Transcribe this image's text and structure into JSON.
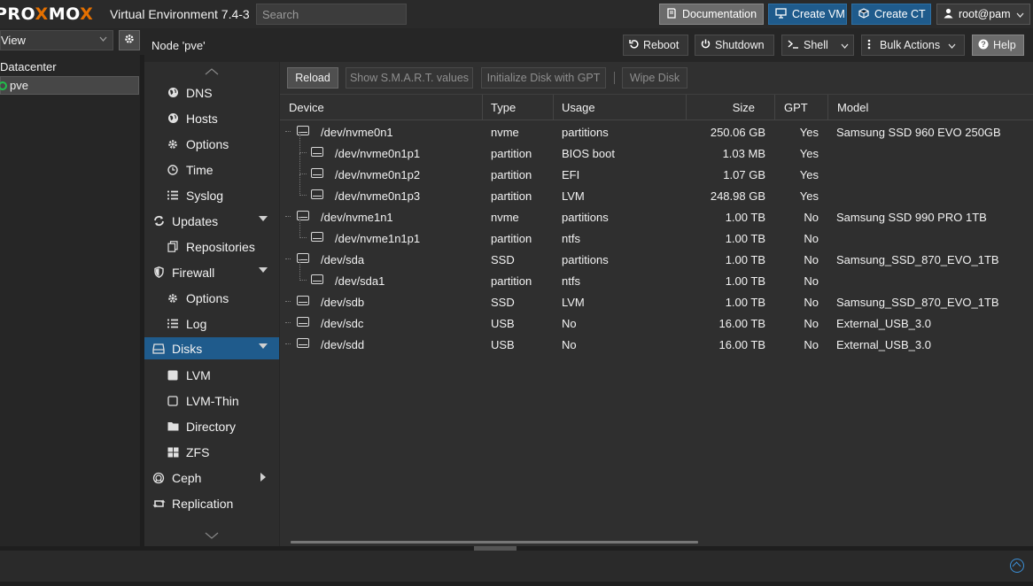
{
  "app": {
    "logo_prefix": "PRO",
    "logo_x": "X",
    "logo_suffix": "MO",
    "logo_x2": "X",
    "version": "Virtual Environment 7.4-3"
  },
  "search": {
    "placeholder": "Search"
  },
  "topbar": {
    "documentation": "Documentation",
    "create_vm": "Create VM",
    "create_ct": "Create CT",
    "user": "root@pam"
  },
  "view": {
    "selected": "View"
  },
  "tree": {
    "datacenter": "Datacenter",
    "node": "pve"
  },
  "node_header": {
    "title": "Node 'pve'",
    "reboot": "Reboot",
    "shutdown": "Shutdown",
    "shell": "Shell",
    "bulk_actions": "Bulk Actions",
    "help": "Help"
  },
  "menu": {
    "items": [
      {
        "label": "DNS",
        "icon": "globe-icon"
      },
      {
        "label": "Hosts",
        "icon": "globe-icon"
      },
      {
        "label": "Options",
        "icon": "gear-icon"
      },
      {
        "label": "Time",
        "icon": "clock-icon"
      },
      {
        "label": "Syslog",
        "icon": "list-icon"
      },
      {
        "label": "Updates",
        "icon": "refresh-icon"
      },
      {
        "label": "Repositories",
        "icon": "files-icon"
      },
      {
        "label": "Firewall",
        "icon": "shield-icon"
      },
      {
        "label": "Options",
        "icon": "gear-icon"
      },
      {
        "label": "Log",
        "icon": "list-icon"
      },
      {
        "label": "Disks",
        "icon": "drive-icon"
      },
      {
        "label": "LVM",
        "icon": "square-filled-icon"
      },
      {
        "label": "LVM-Thin",
        "icon": "square-outline-icon"
      },
      {
        "label": "Directory",
        "icon": "folder-icon"
      },
      {
        "label": "ZFS",
        "icon": "grid-icon"
      },
      {
        "label": "Ceph",
        "icon": "ceph-icon"
      },
      {
        "label": "Replication",
        "icon": "retweet-icon"
      }
    ]
  },
  "toolbar": {
    "reload": "Reload",
    "smart": "Show S.M.A.R.T. values",
    "init_gpt": "Initialize Disk with GPT",
    "wipe": "Wipe Disk"
  },
  "grid": {
    "columns": [
      "Device",
      "Type",
      "Usage",
      "Size",
      "GPT",
      "Model"
    ],
    "rows": [
      {
        "device": "/dev/nvme0n1",
        "type": "nvme",
        "usage": "partitions",
        "size": "250.06 GB",
        "gpt": "Yes",
        "model": "Samsung SSD 960 EVO 250GB",
        "depth": 0
      },
      {
        "device": "/dev/nvme0n1p1",
        "type": "partition",
        "usage": "BIOS boot",
        "size": "1.03 MB",
        "gpt": "Yes",
        "model": "",
        "depth": 1
      },
      {
        "device": "/dev/nvme0n1p2",
        "type": "partition",
        "usage": "EFI",
        "size": "1.07 GB",
        "gpt": "Yes",
        "model": "",
        "depth": 1
      },
      {
        "device": "/dev/nvme0n1p3",
        "type": "partition",
        "usage": "LVM",
        "size": "248.98 GB",
        "gpt": "Yes",
        "model": "",
        "depth": 1
      },
      {
        "device": "/dev/nvme1n1",
        "type": "nvme",
        "usage": "partitions",
        "size": "1.00 TB",
        "gpt": "No",
        "model": "Samsung SSD 990 PRO 1TB",
        "depth": 0
      },
      {
        "device": "/dev/nvme1n1p1",
        "type": "partition",
        "usage": "ntfs",
        "size": "1.00 TB",
        "gpt": "No",
        "model": "",
        "depth": 1
      },
      {
        "device": "/dev/sda",
        "type": "SSD",
        "usage": "partitions",
        "size": "1.00 TB",
        "gpt": "No",
        "model": "Samsung_SSD_870_EVO_1TB",
        "depth": 0
      },
      {
        "device": "/dev/sda1",
        "type": "partition",
        "usage": "ntfs",
        "size": "1.00 TB",
        "gpt": "No",
        "model": "",
        "depth": 1
      },
      {
        "device": "/dev/sdb",
        "type": "SSD",
        "usage": "LVM",
        "size": "1.00 TB",
        "gpt": "No",
        "model": "Samsung_SSD_870_EVO_1TB",
        "depth": 0
      },
      {
        "device": "/dev/sdc",
        "type": "USB",
        "usage": "No",
        "size": "16.00 TB",
        "gpt": "No",
        "model": "External_USB_3.0",
        "depth": 0
      },
      {
        "device": "/dev/sdd",
        "type": "USB",
        "usage": "No",
        "size": "16.00 TB",
        "gpt": "No",
        "model": "External_USB_3.0",
        "depth": 0
      }
    ]
  },
  "colors": {
    "accent": "#1f5b8c",
    "brand_orange": "#e57000",
    "status_green": "#21bf4b"
  }
}
